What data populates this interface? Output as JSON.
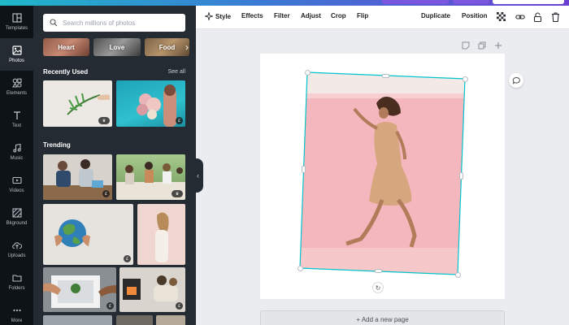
{
  "rail": {
    "items": [
      {
        "label": "Templates",
        "icon": "templates-icon"
      },
      {
        "label": "Photos",
        "icon": "photos-icon",
        "active": true
      },
      {
        "label": "Elements",
        "icon": "elements-icon"
      },
      {
        "label": "Text",
        "icon": "text-icon"
      },
      {
        "label": "Music",
        "icon": "music-icon"
      },
      {
        "label": "Videos",
        "icon": "videos-icon"
      },
      {
        "label": "Bkground",
        "icon": "background-icon"
      },
      {
        "label": "Uploads",
        "icon": "uploads-icon"
      },
      {
        "label": "Folders",
        "icon": "folders-icon"
      },
      {
        "label": "More",
        "icon": "more-icon"
      }
    ]
  },
  "panel": {
    "search_placeholder": "Search millions of photos",
    "chips": [
      "Heart",
      "Love",
      "Food"
    ],
    "recently_used": {
      "title": "Recently Used",
      "see_all": "See all"
    },
    "trending": {
      "title": "Trending"
    }
  },
  "toolbar": {
    "style": "Style",
    "effects": "Effects",
    "filter": "Filter",
    "adjust": "Adjust",
    "crop": "Crop",
    "flip": "Flip",
    "duplicate": "Duplicate",
    "position": "Position"
  },
  "canvas": {
    "add_page": "+ Add a new page"
  },
  "colors": {
    "rail_bg": "#0e1318",
    "panel_bg": "#252b33",
    "selection": "#00c4cc",
    "canvas_bg": "#ebecf0"
  }
}
